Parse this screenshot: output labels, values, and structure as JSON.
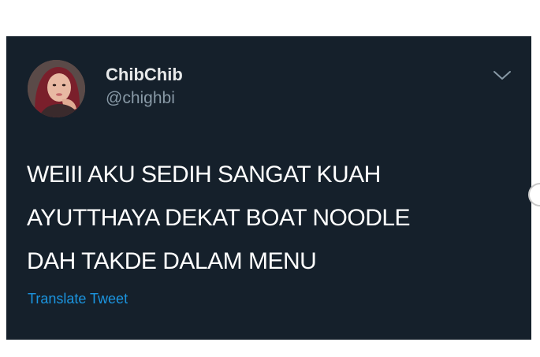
{
  "colors": {
    "card_background": "#15202b",
    "name_text": "#e7e9ea",
    "handle_text": "#8899a6",
    "body_text": "#ffffff",
    "link": "#1b95e0"
  },
  "user": {
    "display_name": "ChibChib",
    "handle": "@chighbi",
    "avatar_icon": "user-avatar-photo"
  },
  "menu": {
    "icon": "chevron-down-icon"
  },
  "tweet": {
    "lines": [
      "WEIII AKU SEDIH SANGAT KUAH",
      "AYUTTHAYA DEKAT BOAT NOODLE",
      "DAH TAKDE DALAM MENU"
    ],
    "translate_label": "Translate Tweet"
  }
}
